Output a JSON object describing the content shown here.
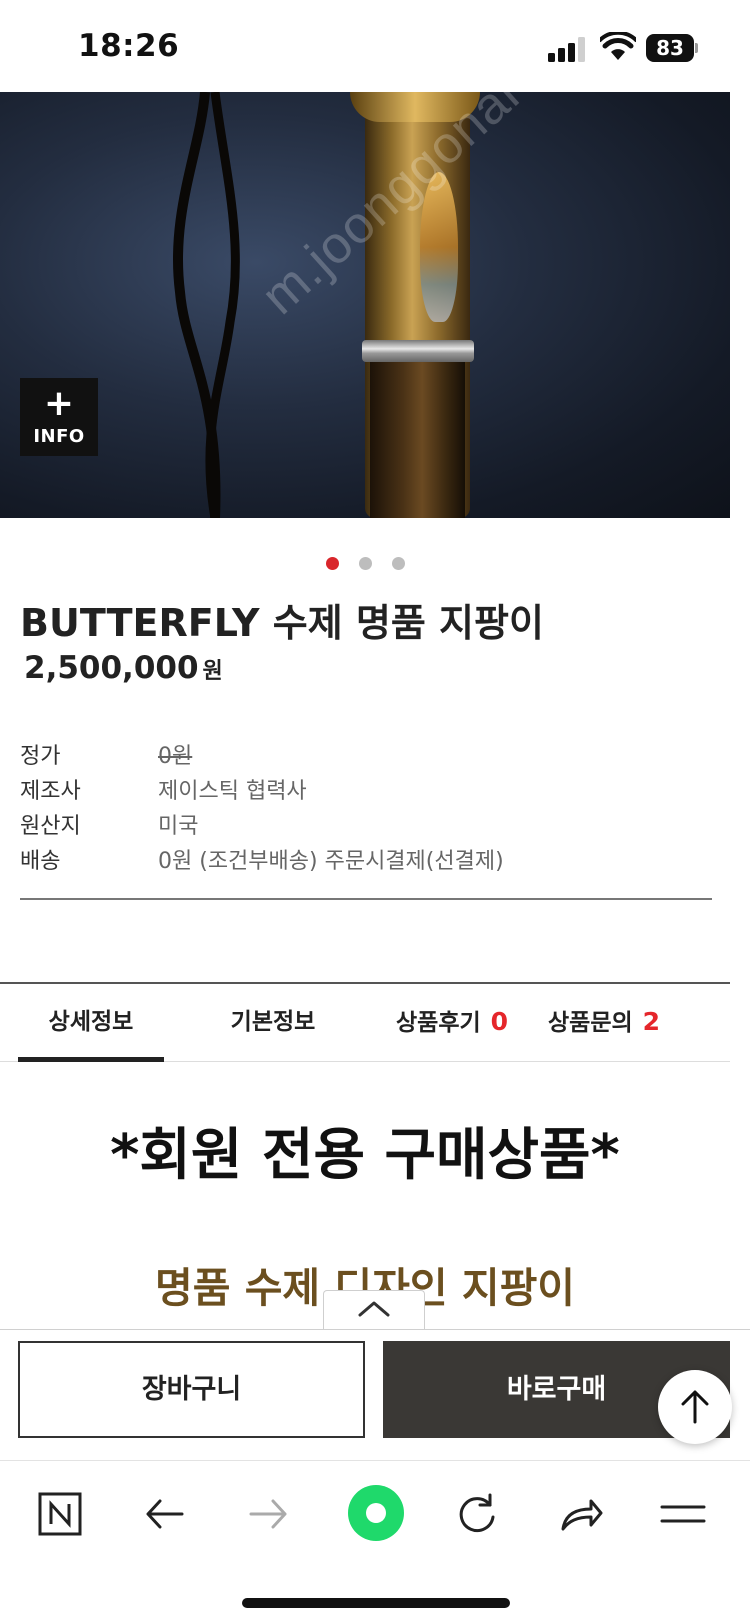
{
  "status_bar": {
    "time": "18:26",
    "battery": "83"
  },
  "hero": {
    "watermark": "m.joonggonara.naver.com",
    "info_button_label": "INFO",
    "info_button_plus": "+",
    "slide_count": 3,
    "active_slide": 1
  },
  "product": {
    "title": "BUTTERFLY 수제 명품 지팡이",
    "price": "2,500,000",
    "price_unit": "원",
    "specs": [
      {
        "key": "정가",
        "value": "0원",
        "strikethrough": true
      },
      {
        "key": "제조사",
        "value": "제이스틱 협력사",
        "strikethrough": false
      },
      {
        "key": "원산지",
        "value": "미국",
        "strikethrough": false
      },
      {
        "key": "배송",
        "value": "0원 (조건부배송) 주문시결제(선결제)",
        "strikethrough": false
      }
    ]
  },
  "tabs": [
    {
      "label": "상세정보",
      "active": true
    },
    {
      "label": "기본정보",
      "active": false
    },
    {
      "label": "상품후기",
      "count": "0",
      "active": false
    },
    {
      "label": "상품문의",
      "count": "2",
      "active": false
    }
  ],
  "content": {
    "headline": "*회원 전용 구매상품*",
    "subheadline": "명품 수제 디자인 지팡이"
  },
  "actions": {
    "cart_label": "장바구니",
    "buy_label": "바로구매"
  },
  "colors": {
    "accent_red": "#e5262b",
    "buy_button_bg": "#3a3835",
    "subheadline_gold": "#6b4f1f"
  },
  "browser_toolbar": {
    "icons": [
      "naver-n-icon",
      "back-arrow-icon",
      "forward-arrow-icon",
      "green-dot-icon",
      "reload-icon",
      "share-icon",
      "menu-icon"
    ]
  }
}
